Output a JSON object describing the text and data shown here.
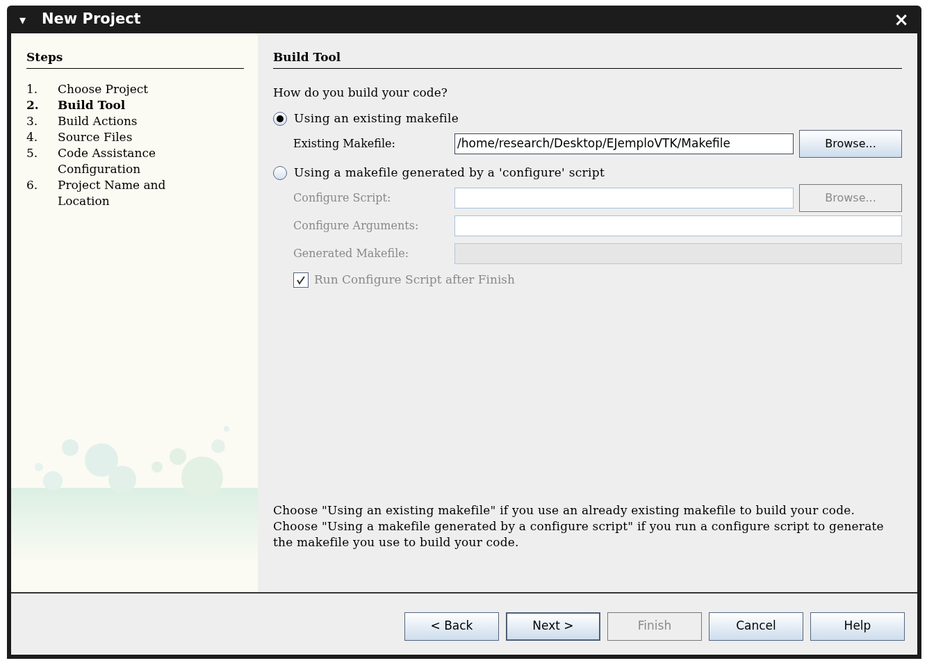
{
  "window": {
    "title": "New Project",
    "menu_glyph": "▾",
    "close_glyph": "×"
  },
  "steps": {
    "title": "Steps",
    "items": [
      {
        "number": "1.",
        "label": "Choose Project",
        "selected": false
      },
      {
        "number": "2.",
        "label": "Build Tool",
        "selected": true
      },
      {
        "number": "3.",
        "label": "Build Actions",
        "selected": false
      },
      {
        "number": "4.",
        "label": "Source Files",
        "selected": false
      },
      {
        "number": "5.",
        "label": "Code Assistance Configuration",
        "selected": false
      },
      {
        "number": "6.",
        "label": "Project Name and Location",
        "selected": false
      }
    ]
  },
  "panel": {
    "title": "Build Tool",
    "question": "How do you build your code?",
    "options": [
      {
        "label": "Using an existing makefile",
        "selected": true,
        "fields": [
          {
            "label": "Existing Makefile:",
            "value": "/home/research/Desktop/EJemploVTK/Makefile",
            "disabled": false,
            "button": {
              "label": "Browse...",
              "disabled": false
            }
          }
        ]
      },
      {
        "label": "Using a makefile generated by a 'configure' script",
        "selected": false,
        "fields": [
          {
            "label": "Configure Script:",
            "disabled": false,
            "button": {
              "label": "Browse...",
              "disabled": true
            }
          },
          {
            "label": "Configure Arguments:",
            "disabled": false
          },
          {
            "label": "Generated Makefile:",
            "disabled": true
          }
        ],
        "checkbox": {
          "label": "Run Configure Script after Finish",
          "checked": true
        }
      }
    ],
    "help_text": "Choose \"Using an existing makefile\" if you use an already existing makefile to build your code. Choose \"Using a makefile generated by a configure script\" if you run a configure script to generate the makefile you use to build your code."
  },
  "buttons": [
    {
      "label": "< Back",
      "disabled": false,
      "default": false
    },
    {
      "label": "Next >",
      "disabled": false,
      "default": true
    },
    {
      "label": "Finish",
      "disabled": true,
      "default": false
    },
    {
      "label": "Cancel",
      "disabled": false,
      "default": false
    },
    {
      "label": "Help",
      "disabled": false,
      "default": false
    }
  ]
}
